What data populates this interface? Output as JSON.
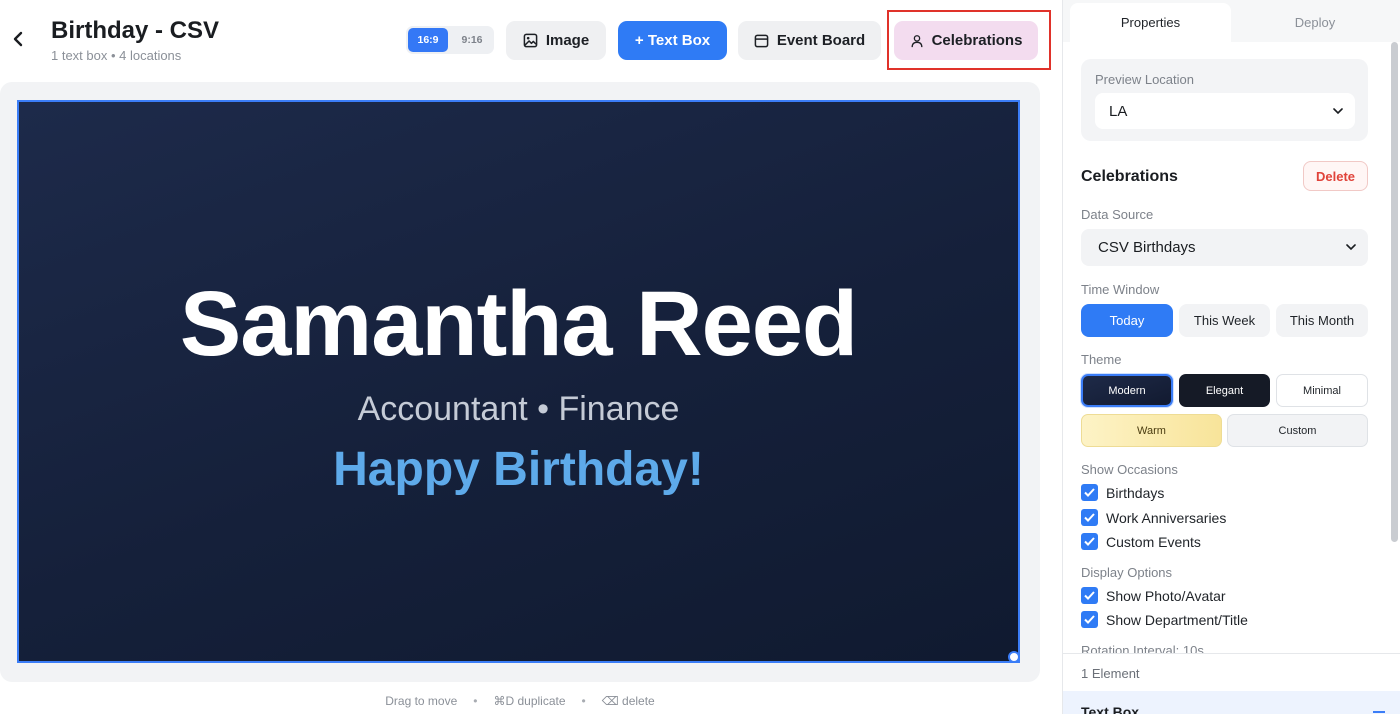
{
  "header": {
    "title": "Birthday - CSV",
    "subtitle": "1 text box • 4 locations",
    "ratio": {
      "active": "16:9",
      "inactive": "9:16"
    },
    "buttons": {
      "image": "Image",
      "text_box": "+ Text Box",
      "event_board": "Event Board",
      "celebrations": "Celebrations"
    }
  },
  "slide": {
    "name": "Samantha Reed",
    "role": "Accountant • Finance",
    "greeting": "Happy Birthday!"
  },
  "hints": {
    "drag": "Drag to move",
    "duplicate": "⌘D duplicate",
    "delete": "⌫ delete"
  },
  "panel": {
    "tabs": {
      "properties": "Properties",
      "deploy": "Deploy"
    },
    "preview_location": {
      "label": "Preview Location",
      "value": "LA"
    },
    "section_title": "Celebrations",
    "delete_label": "Delete",
    "data_source": {
      "label": "Data Source",
      "value": "CSV Birthdays"
    },
    "time_window": {
      "label": "Time Window",
      "options": [
        "Today",
        "This Week",
        "This Month"
      ],
      "selected": "Today"
    },
    "theme": {
      "label": "Theme",
      "options": [
        "Modern",
        "Elegant",
        "Minimal",
        "Warm",
        "Custom"
      ],
      "selected": "Modern"
    },
    "occasions": {
      "label": "Show Occasions",
      "items": [
        "Birthdays",
        "Work Anniversaries",
        "Custom Events"
      ]
    },
    "display": {
      "label": "Display Options",
      "items": [
        "Show Photo/Avatar",
        "Show Department/Title"
      ]
    },
    "rotation_label": "Rotation Interval: 10s",
    "element_count": "1 Element",
    "element_item": "Text Box"
  },
  "colors": {
    "accent": "#2f7bf5",
    "highlight": "#e0322a",
    "danger": "#e0433a",
    "greeting": "#5eaaea"
  }
}
